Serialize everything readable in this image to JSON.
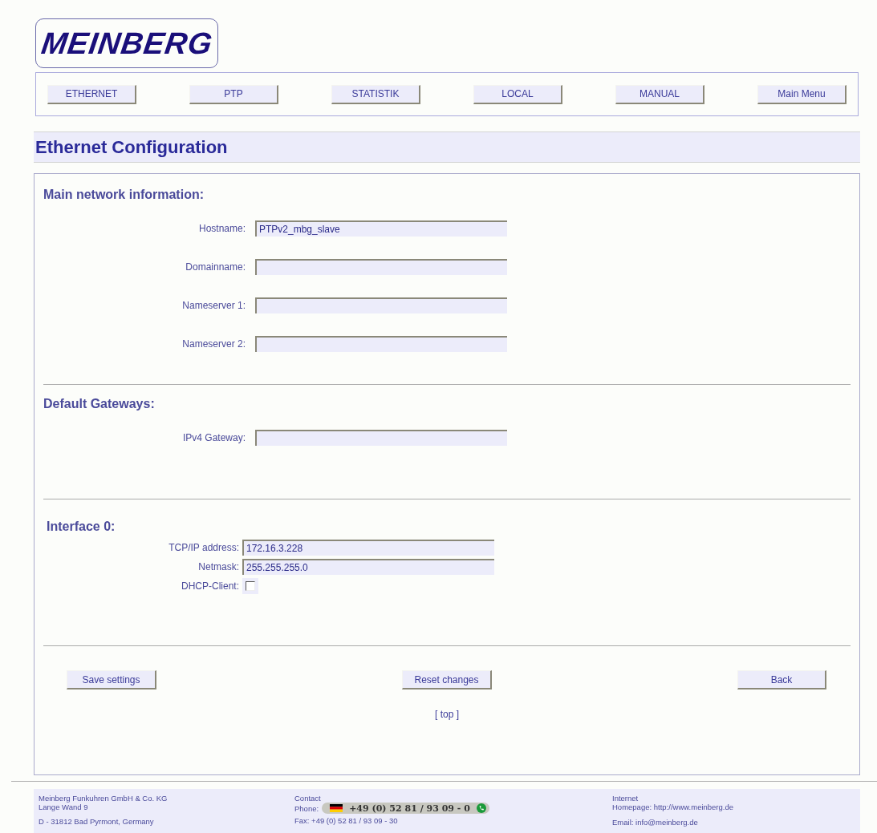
{
  "logo": "MEINBERG",
  "nav": [
    "ETHERNET",
    "PTP",
    "STATISTIK",
    "LOCAL",
    "MANUAL",
    "Main Menu"
  ],
  "page_title": "Ethernet Configuration",
  "sections": [
    {
      "heading": "Main network information:",
      "fields": [
        {
          "label": "Hostname:",
          "value": "PTPv2_mbg_slave"
        },
        {
          "label": "Domainname:"
        },
        {
          "label": "Nameserver 1:"
        },
        {
          "label": "Nameserver 2:"
        }
      ]
    },
    {
      "heading": "Default Gateways:",
      "fields": [
        {
          "label": "IPv4 Gateway:"
        }
      ]
    }
  ],
  "interface": {
    "heading": "Interface 0:",
    "fields": [
      {
        "kind": "text",
        "label": "TCP/IP address:",
        "value": "172.16.3.228"
      },
      {
        "kind": "text",
        "label": "Netmask:",
        "value": "255.255.255.0"
      },
      {
        "kind": "checkbox",
        "label": "DHCP-Client:",
        "checked": false
      }
    ]
  },
  "buttons": [
    "Save settings",
    "Reset changes",
    "Back"
  ],
  "top_link": "[ top ]",
  "footer": {
    "company": [
      "Meinberg Funkuhren GmbH & Co. KG",
      "Lange Wand 9",
      "D - 31812 Bad Pyrmont, Germany"
    ],
    "contact_title": "Contact",
    "phone_label": "Phone:",
    "phone": "+49 (0) 52 81 / 93 09 - 0",
    "fax": "Fax: +49 (0) 52 81 / 93 09 - 30",
    "internet_title": "Internet",
    "homepage": "Homepage: http://www.meinberg.de",
    "email": "Email: info@meinberg.de"
  }
}
